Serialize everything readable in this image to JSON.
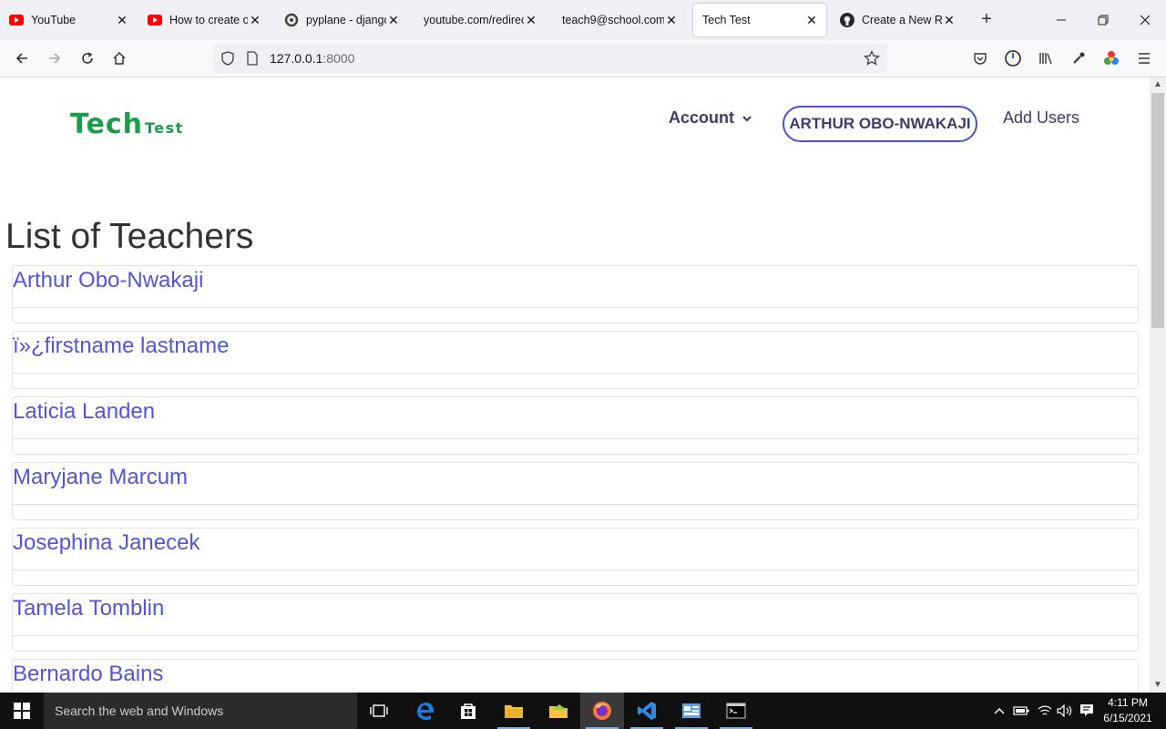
{
  "browser": {
    "tabs": [
      {
        "title": "YouTube",
        "icon": "youtube-icon",
        "active": false
      },
      {
        "title": "How to create obj",
        "icon": "youtube-icon",
        "active": false
      },
      {
        "title": "pyplane - django",
        "icon": "pyplane-icon",
        "active": false
      },
      {
        "title": "youtube.com/redirect",
        "icon": "",
        "active": false
      },
      {
        "title": "teach9@school.com |",
        "icon": "",
        "active": false
      },
      {
        "title": "Tech Test",
        "icon": "",
        "active": true
      },
      {
        "title": "Create a New Rep",
        "icon": "github-icon",
        "active": false
      }
    ],
    "url_host": "127.0.0.1",
    "url_port": ":8000"
  },
  "site": {
    "logo_main": "Tech",
    "logo_sub": "Test",
    "account_label": "Account",
    "user_name": "ARTHUR OBO-NWAKAJI",
    "add_users_label": "Add Users"
  },
  "main": {
    "heading": "List of Teachers",
    "teachers": [
      "Arthur Obo-Nwakaji",
      "ï»¿firstname lastname",
      "Laticia Landen",
      "Maryjane Marcum",
      "Josephina Janecek",
      "Tamela Tomblin",
      "Bernardo Bains"
    ]
  },
  "taskbar": {
    "search_placeholder": "Search the web and Windows",
    "time": "4:11 PM",
    "date": "6/15/2021"
  },
  "colors": {
    "logo_green": "#1a9c4a",
    "link_purple": "#5454d8",
    "nav_text": "#3c3d6b",
    "pill_border": "#4b4fd1"
  }
}
